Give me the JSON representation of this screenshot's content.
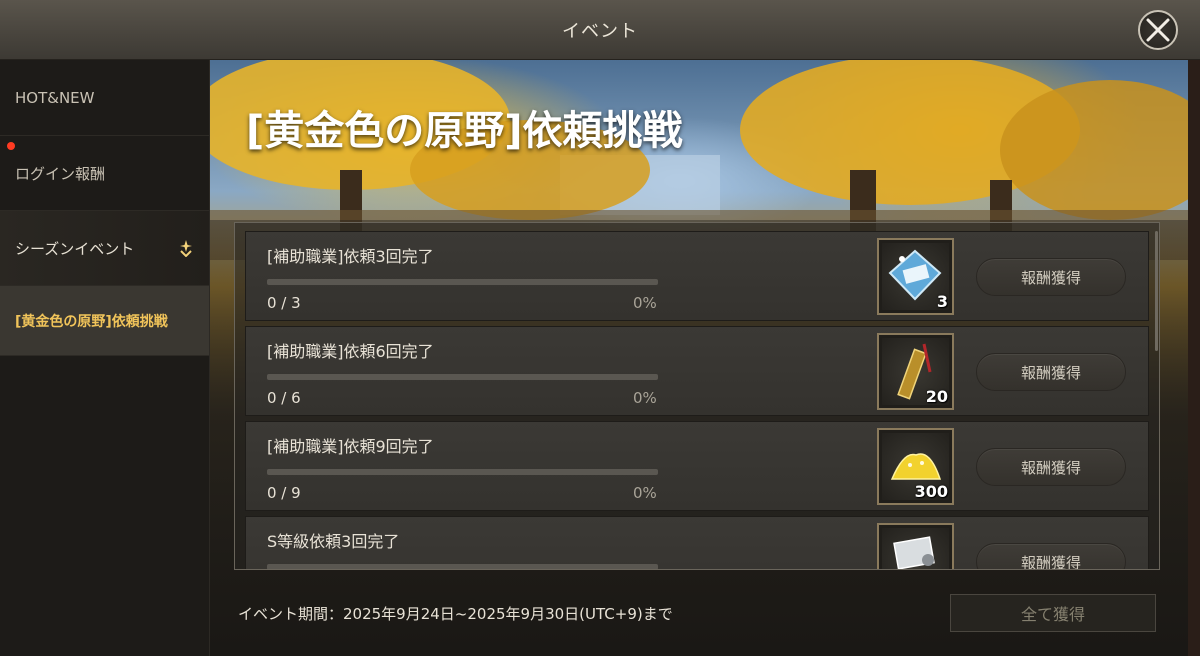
{
  "header": {
    "title": "イベント"
  },
  "sidebar": {
    "items": [
      {
        "label": "HOT&NEW"
      },
      {
        "label": "ログイン報酬"
      },
      {
        "label": "シーズンイベント"
      },
      {
        "label": "[黄金色の原野]依頼挑戦"
      }
    ]
  },
  "event": {
    "title": "[黄金色の原野]依頼挑戦",
    "tasks": [
      {
        "name": "[補助職業]依頼3回完了",
        "count": "0 / 3",
        "percent": "0%",
        "progress": 0,
        "reward_icon": "scroll-ticket-icon",
        "reward_qty": "3",
        "button": "報酬獲得"
      },
      {
        "name": "[補助職業]依頼6回完了",
        "count": "0 / 6",
        "percent": "0%",
        "progress": 0,
        "reward_icon": "bookmark-tassel-icon",
        "reward_qty": "20",
        "button": "報酬獲得"
      },
      {
        "name": "[補助職業]依頼9回完了",
        "count": "0 / 9",
        "percent": "0%",
        "progress": 0,
        "reward_icon": "gold-dust-icon",
        "reward_qty": "300",
        "button": "報酬獲得"
      },
      {
        "name": "S等級依頼3回完了",
        "reward_icon": "document-icon",
        "button": "報酬獲得"
      }
    ],
    "period": "イベント期間：2025年9月24日~2025年9月30日(UTC+9)まで",
    "claim_all": "全て獲得"
  },
  "colors": {
    "accent_gold": "#f1c45a",
    "notification": "#ff3b22"
  }
}
